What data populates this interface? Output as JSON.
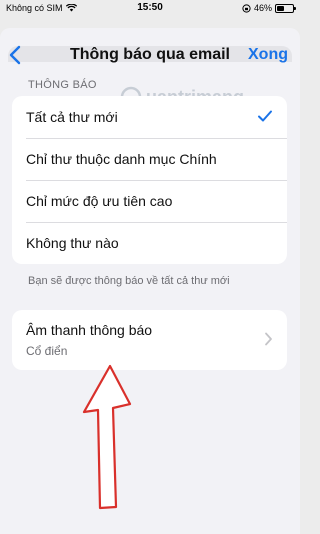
{
  "status_bar": {
    "carrier": "Không có SIM",
    "time": "15:50",
    "battery": "46%",
    "battery_level": 0.46
  },
  "nav": {
    "title": "Thông báo qua email",
    "done_label": "Xong",
    "back_icon": "chevron-left-icon"
  },
  "section": {
    "header": "THÔNG BÁO",
    "options": [
      {
        "label": "Tất cả thư mới",
        "selected": true
      },
      {
        "label": "Chỉ thư thuộc danh mục Chính",
        "selected": false
      },
      {
        "label": "Chỉ mức độ ưu tiên cao",
        "selected": false
      },
      {
        "label": "Không thư nào",
        "selected": false
      }
    ],
    "footer": "Bạn sẽ được thông báo về tất cả thư mới"
  },
  "sound": {
    "title": "Âm thanh thông báo",
    "value": "Cổ điển"
  },
  "watermark": {
    "text": "uantrimang"
  },
  "colors": {
    "accent": "#1a73e8",
    "annotation": "#d9302b"
  }
}
